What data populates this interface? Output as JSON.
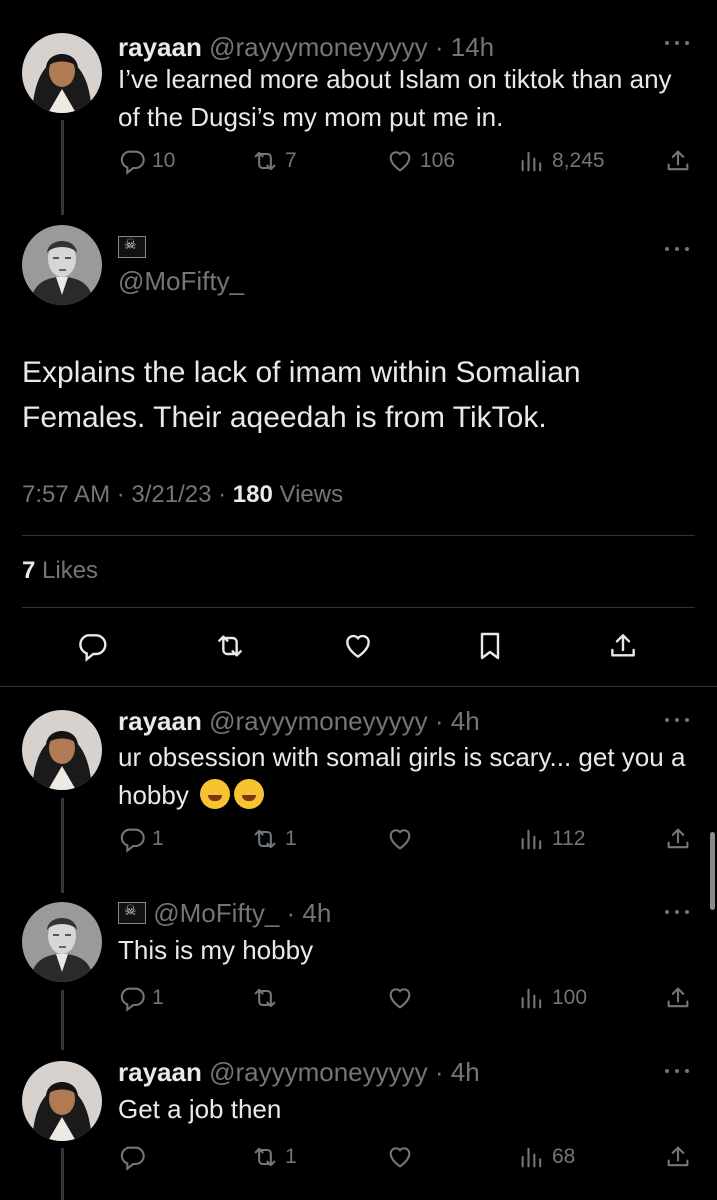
{
  "tweet1": {
    "name": "rayaan",
    "handle": "@rayyymoneyyyyy",
    "sep": " · ",
    "time": "14h",
    "text": "I’ve learned more about Islam on tiktok than any of the Dugsi’s my mom put me in.",
    "replies": "10",
    "retweets": "7",
    "likes": "106",
    "views": "8,245"
  },
  "main_tweet": {
    "handle": "@MoFifty_",
    "text": "Explains the lack of imam within Somalian Females. Their aqeedah is from TikTok.",
    "time": "7:57 AM",
    "dot1": " · ",
    "date": "3/21/23",
    "dot2": " · ",
    "views_count": "180",
    "views_label": " Views",
    "likes_count": "7",
    "likes_label": " Likes"
  },
  "reply1": {
    "name": "rayaan",
    "handle": "@rayyymoneyyyyy",
    "sep": " · ",
    "time": "4h",
    "text": "ur obsession with somali girls is scary... get you a hobby",
    "replies": "1",
    "retweets": "1",
    "likes": "",
    "views": "112"
  },
  "reply2": {
    "handle": "@MoFifty_",
    "sep": " · ",
    "time": "4h",
    "text": "This is my hobby",
    "replies": "1",
    "retweets": "",
    "likes": "",
    "views": "100"
  },
  "reply3": {
    "name": "rayaan",
    "handle": "@rayyymoneyyyyy",
    "sep": " · ",
    "time": "4h",
    "text": "Get a job then",
    "replies": "",
    "retweets": "1",
    "likes": "",
    "views": "68"
  },
  "colors": {
    "background": "#000000",
    "text": "#e7e9ea",
    "muted": "#71767b",
    "divider": "#2f3336"
  }
}
